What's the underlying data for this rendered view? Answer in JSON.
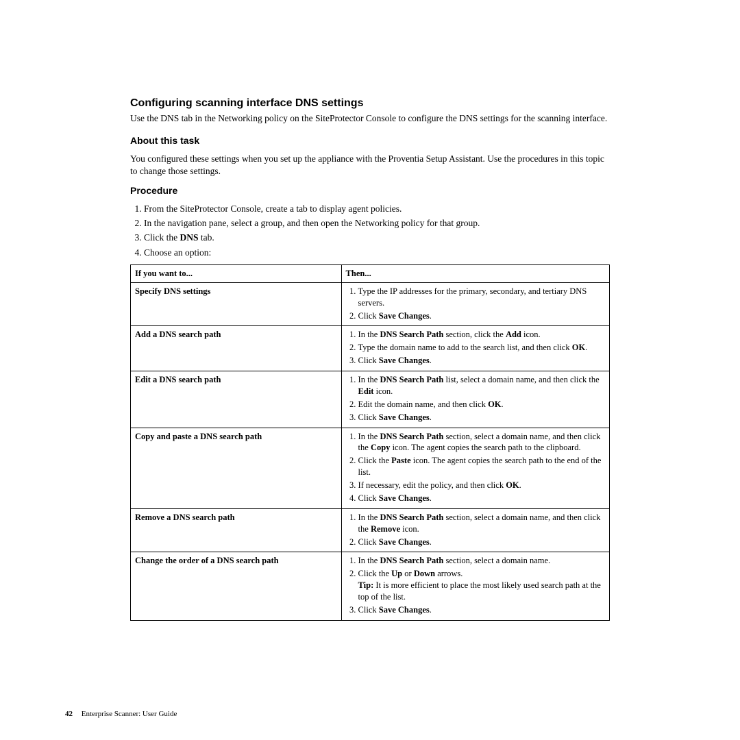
{
  "title": "Configuring scanning interface DNS settings",
  "intro": "Use the DNS tab in the Networking policy on the SiteProtector Console to configure the DNS settings for the scanning interface.",
  "about_heading": "About this task",
  "about_text": "You configured these settings when you set up the appliance with the Proventia Setup Assistant. Use the procedures in this topic to change those settings.",
  "procedure_heading": "Procedure",
  "proc": {
    "s1": "From the SiteProtector Console, create a tab to display agent policies.",
    "s2": "In the navigation pane, select a group, and then open the Networking policy for that group.",
    "s3_a": "Click the ",
    "s3_b": "DNS",
    "s3_c": " tab.",
    "s4": "Choose an option:"
  },
  "table": {
    "h1": "If you want to...",
    "h2": "Then...",
    "r1_left": "Specify DNS settings",
    "r1_1": "Type the IP addresses for the primary, secondary, and tertiary DNS servers.",
    "r1_2a": "Click ",
    "r1_2b": "Save Changes",
    "r1_2c": ".",
    "r2_left": "Add a DNS search path",
    "r2_1a": "In the ",
    "r2_1b": "DNS Search Path",
    "r2_1c": " section, click the ",
    "r2_1d": "Add",
    "r2_1e": " icon.",
    "r2_2a": "Type the domain name to add to the search list, and then click ",
    "r2_2b": "OK",
    "r2_2c": ".",
    "r2_3a": "Click ",
    "r2_3b": "Save Changes",
    "r2_3c": ".",
    "r3_left": "Edit a DNS search path",
    "r3_1a": "In the ",
    "r3_1b": "DNS Search Path",
    "r3_1c": " list, select a domain name, and then click the ",
    "r3_1d": "Edit",
    "r3_1e": " icon.",
    "r3_2a": "Edit the domain name, and then click ",
    "r3_2b": "OK",
    "r3_2c": ".",
    "r3_3a": "Click ",
    "r3_3b": "Save Changes",
    "r3_3c": ".",
    "r4_left": "Copy and paste a DNS search path",
    "r4_1a": "In the ",
    "r4_1b": "DNS Search Path",
    "r4_1c": " section, select a domain name, and then click the ",
    "r4_1d": "Copy",
    "r4_1e": " icon. The agent copies the search path to the clipboard.",
    "r4_2a": "Click the ",
    "r4_2b": "Paste",
    "r4_2c": " icon. The agent copies the search path to the end of the list.",
    "r4_3a": "If necessary, edit the policy, and then click ",
    "r4_3b": "OK",
    "r4_3c": ".",
    "r4_4a": "Click ",
    "r4_4b": "Save Changes",
    "r4_4c": ".",
    "r5_left": "Remove a DNS search path",
    "r5_1a": "In the ",
    "r5_1b": "DNS Search Path",
    "r5_1c": " section, select a domain name, and then click the ",
    "r5_1d": "Remove",
    "r5_1e": " icon.",
    "r5_2a": "Click ",
    "r5_2b": "Save Changes",
    "r5_2c": ".",
    "r6_left": "Change the order of a DNS search path",
    "r6_1a": "In the ",
    "r6_1b": "DNS Search Path",
    "r6_1c": " section, select a domain name.",
    "r6_2a": "Click the ",
    "r6_2b": "Up",
    "r6_2c": " or ",
    "r6_2d": "Down",
    "r6_2e": " arrows.",
    "r6_tip_a": "Tip:",
    "r6_tip_b": " It is more efficient to place the most likely used search path at the top of the list.",
    "r6_3a": "Click ",
    "r6_3b": "Save Changes",
    "r6_3c": "."
  },
  "footer": {
    "pagenum": "42",
    "doc": "Enterprise Scanner: User Guide"
  }
}
